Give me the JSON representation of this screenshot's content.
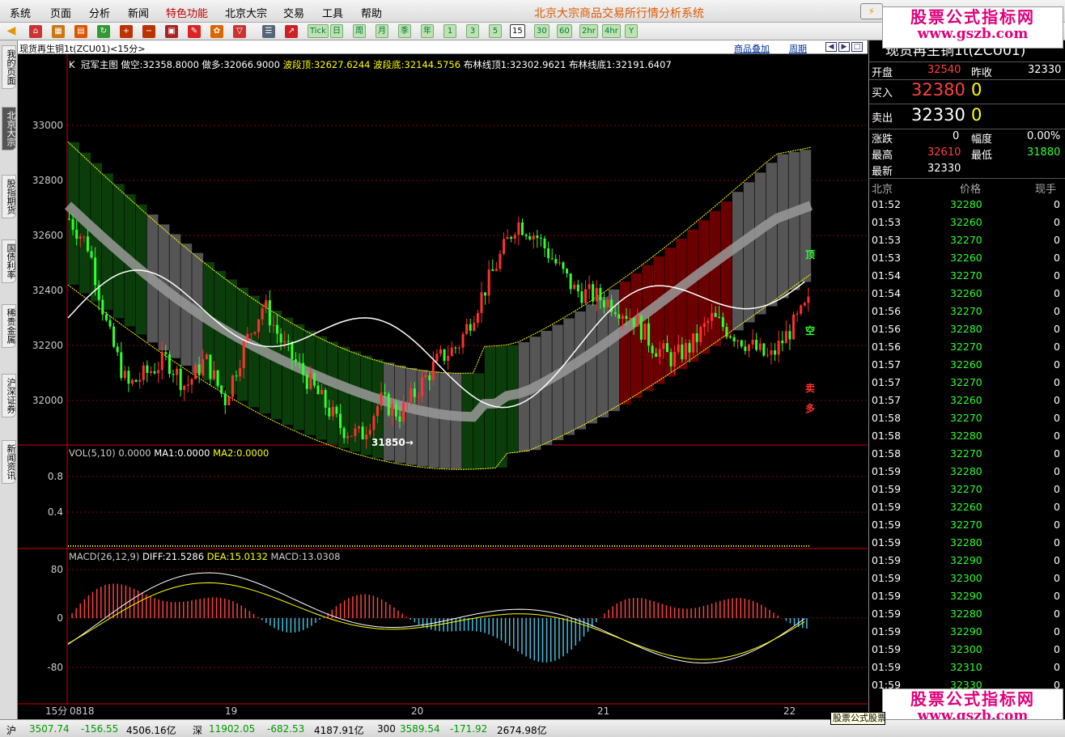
{
  "app_title": "北京大宗商品交易所行情分析系统",
  "menu": [
    "系统",
    "页面",
    "分析",
    "新闻",
    "特色功能",
    "北京大宗",
    "交易",
    "工具",
    "帮助"
  ],
  "toolbar": {
    "periods": [
      "Tick",
      "日",
      "周",
      "月",
      "季",
      "年",
      "1",
      "3",
      "5",
      "15",
      "30",
      "60",
      "2hr",
      "4hr",
      "Y"
    ],
    "active_period": "15"
  },
  "left_tabs": [
    "我的页面",
    "北京大宗",
    "股指期货",
    "国债利率",
    "稀贵金属",
    "沪深证券",
    "新闻资讯"
  ],
  "left_tab_active": "北京大宗",
  "chart": {
    "symbol_label": "现货再生铜1t(ZCU01)<15分>",
    "overlay_link": "商品叠加",
    "period_link": "周期",
    "main_legend": {
      "k": "K",
      "name": "冠军主图",
      "items": [
        {
          "text": "做空:32358.8000",
          "color": "#ffffff"
        },
        {
          "text": "做多:32066.9000",
          "color": "#ffffff"
        },
        {
          "text": "波段顶:32627.6244",
          "color": "#ffff00"
        },
        {
          "text": "波段底:32144.5756",
          "color": "#ffff00"
        },
        {
          "text": "布林线顶1:32302.9621",
          "color": "#ffffff"
        },
        {
          "text": "布林线底1:32191.6407",
          "color": "#ffffff"
        }
      ]
    },
    "price_axis": [
      "33000",
      "32800",
      "32600",
      "32400",
      "32200",
      "32000"
    ],
    "low_marker": "31850",
    "signal_labels": {
      "top": "顶",
      "short": "空",
      "sell": "卖",
      "long": "多"
    },
    "vol_legend": {
      "name": "VOL(5,10)",
      "value": "0.0000",
      "ma1": "MA1:0.0000",
      "ma2": "MA2:0.0000"
    },
    "vol_axis": [
      "0.8",
      "0.4"
    ],
    "macd_legend": {
      "name": "MACD(26,12,9)",
      "diff": "DIFF:21.5286",
      "dea": "DEA:15.0132",
      "macd": "MACD:13.0308"
    },
    "macd_axis": [
      "80",
      "0",
      "-80"
    ],
    "time_axis": {
      "period": "15分",
      "labels": [
        "0818",
        "19",
        "20",
        "21",
        "22"
      ]
    }
  },
  "quote": {
    "title": "现货再生铜1t(ZCU01)",
    "open_label": "开盘",
    "open": "32540",
    "prev_close_label": "昨收",
    "prev_close": "32330",
    "buy_label": "买入",
    "buy_price": "32380",
    "buy_vol": "0",
    "sell_label": "卖出",
    "sell_price": "32330",
    "sell_vol": "0",
    "change_label": "涨跌",
    "change": "0",
    "amp_label": "幅度",
    "amp": "0.00%",
    "high_label": "最高",
    "high": "32610",
    "low_label": "最低",
    "low": "31880",
    "last_label": "最新",
    "last": "32330",
    "ticks_header": {
      "place": "北京",
      "price": "价格",
      "vol": "现手"
    },
    "ticks": [
      [
        "01:52",
        "32280",
        "0"
      ],
      [
        "01:53",
        "32260",
        "0"
      ],
      [
        "01:53",
        "32270",
        "0"
      ],
      [
        "01:53",
        "32260",
        "0"
      ],
      [
        "01:54",
        "32270",
        "0"
      ],
      [
        "01:54",
        "32260",
        "0"
      ],
      [
        "01:56",
        "32270",
        "0"
      ],
      [
        "01:56",
        "32280",
        "0"
      ],
      [
        "01:56",
        "32270",
        "0"
      ],
      [
        "01:57",
        "32260",
        "0"
      ],
      [
        "01:57",
        "32270",
        "0"
      ],
      [
        "01:57",
        "32260",
        "0"
      ],
      [
        "01:58",
        "32270",
        "0"
      ],
      [
        "01:58",
        "32280",
        "0"
      ],
      [
        "01:58",
        "32270",
        "0"
      ],
      [
        "01:59",
        "32280",
        "0"
      ],
      [
        "01:59",
        "32270",
        "0"
      ],
      [
        "01:59",
        "32260",
        "0"
      ],
      [
        "01:59",
        "32270",
        "0"
      ],
      [
        "01:59",
        "32280",
        "0"
      ],
      [
        "01:59",
        "32290",
        "0"
      ],
      [
        "01:59",
        "32300",
        "0"
      ],
      [
        "01:59",
        "32290",
        "0"
      ],
      [
        "01:59",
        "32280",
        "0"
      ],
      [
        "01:59",
        "32290",
        "0"
      ],
      [
        "01:59",
        "32300",
        "0"
      ],
      [
        "01:59",
        "32310",
        "0"
      ],
      [
        "01:59",
        "32330",
        "0"
      ]
    ]
  },
  "watermark": {
    "line1": "股票公式指标网",
    "line2": "www.gszb.com"
  },
  "tooltip": "股票公式股票",
  "status": {
    "sh_label": "沪",
    "sh_index": "3507.74",
    "sh_change": "-156.55",
    "sh_amount": "4506.16亿",
    "sz_label": "深",
    "sz_index": "11902.05",
    "sz_change": "-682.53",
    "sz_amount": "4187.91亿",
    "hs300_label": "300",
    "hs300_index": "3589.54",
    "hs300_change": "-171.92",
    "hs300_amount": "2674.98亿"
  }
}
